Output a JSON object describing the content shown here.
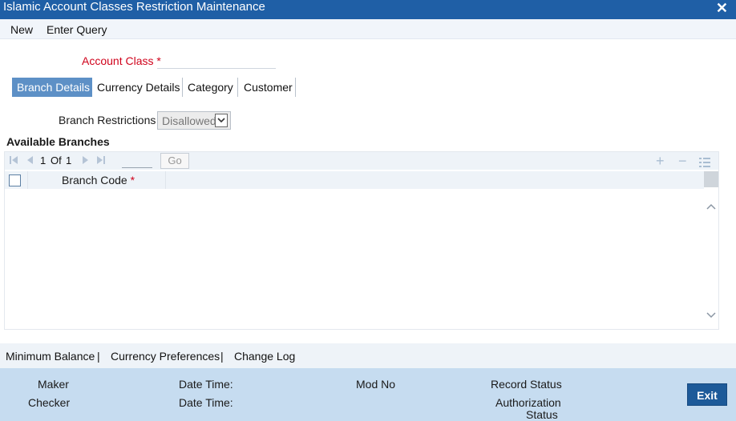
{
  "window": {
    "title": "Islamic Account Classes Restriction Maintenance",
    "close_glyph": "✕"
  },
  "menu": {
    "new_label": "New",
    "enter_query_label": "Enter Query"
  },
  "form": {
    "account_class_label": "Account Class",
    "required_mark": "*",
    "account_class_value": ""
  },
  "tabs": [
    {
      "label": "Branch Details",
      "active": true
    },
    {
      "label": "Currency Details",
      "active": false
    },
    {
      "label": "Category",
      "active": false
    },
    {
      "label": "Customer",
      "active": false
    }
  ],
  "branch": {
    "restrictions_label": "Branch Restrictions",
    "restrictions_value": "Disallowed",
    "available_title": "Available Branches"
  },
  "pager": {
    "current": "1",
    "of_label": "Of",
    "total": "1",
    "go_label": "Go"
  },
  "table": {
    "column_branch_code": "Branch Code",
    "required_mark": "*"
  },
  "bottom_links": {
    "minimum_balance": "Minimum Balance",
    "currency_preferences": "Currency Preferences",
    "change_log": "Change Log",
    "separator": "|"
  },
  "footer": {
    "maker": "Maker",
    "checker": "Checker",
    "date_time_1": "Date Time:",
    "date_time_2": "Date Time:",
    "mod_no": "Mod No",
    "record_status": "Record Status",
    "authorization_status_line1": "Authorization",
    "authorization_status_line2": "Status",
    "exit_label": "Exit"
  },
  "colors": {
    "title_bar": "#1f5fa6",
    "active_tab": "#5d90c6",
    "required": "#d0021b",
    "footer": "#c6dcf0",
    "exit_button": "#1d5a99"
  }
}
